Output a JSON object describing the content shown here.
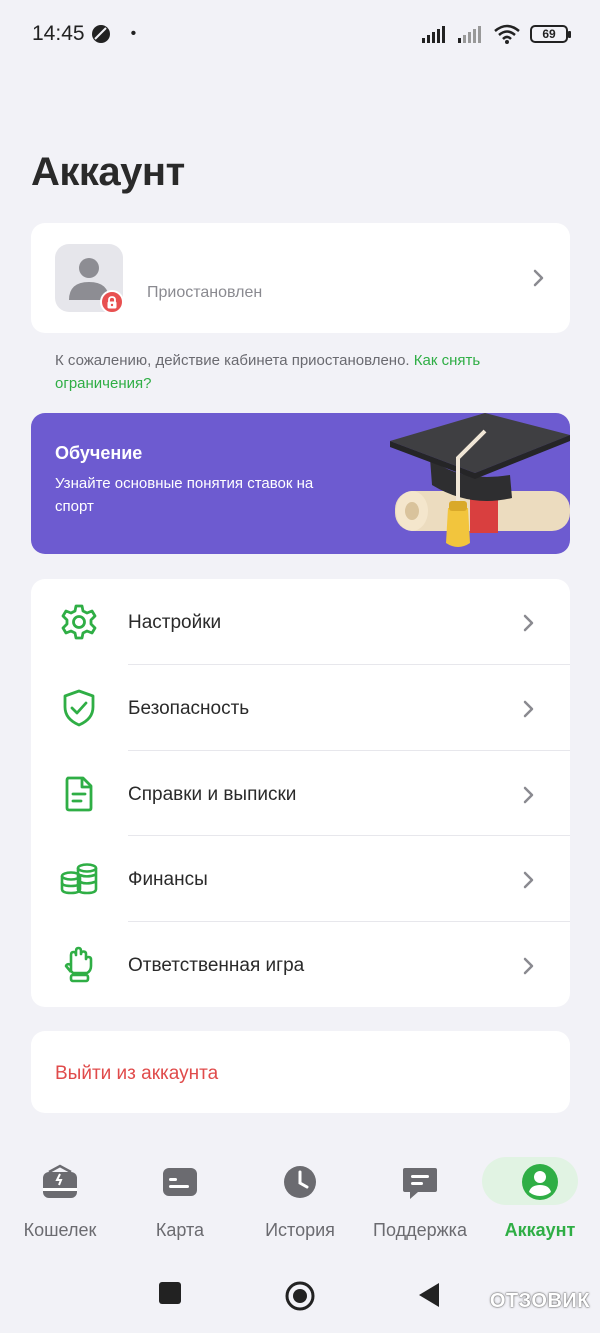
{
  "status_bar": {
    "time": "14:45",
    "battery": "69"
  },
  "page": {
    "title": "Аккаунт"
  },
  "profile": {
    "status": "Приостановлен"
  },
  "notice": {
    "text": "К сожалению, действие кабинета приостановлено.",
    "link": "Как снять ограничения?"
  },
  "promo": {
    "title": "Обучение",
    "subtitle": "Узнайте основные понятия ставок на спорт"
  },
  "menu": {
    "items": [
      {
        "label": "Настройки",
        "icon": "gear-icon"
      },
      {
        "label": "Безопасность",
        "icon": "shield-check-icon"
      },
      {
        "label": "Справки и выписки",
        "icon": "document-icon"
      },
      {
        "label": "Финансы",
        "icon": "coins-icon"
      },
      {
        "label": "Ответственная игра",
        "icon": "hand-icon"
      }
    ]
  },
  "logout": {
    "label": "Выйти из аккаунта"
  },
  "bottom_nav": {
    "items": [
      {
        "label": "Кошелек",
        "icon": "wallet-icon"
      },
      {
        "label": "Карта",
        "icon": "card-icon"
      },
      {
        "label": "История",
        "icon": "clock-icon"
      },
      {
        "label": "Поддержка",
        "icon": "chat-icon"
      },
      {
        "label": "Аккаунт",
        "icon": "account-icon",
        "active": true
      }
    ]
  },
  "watermark": "ОТЗОВИК",
  "colors": {
    "accent": "#2fae45",
    "promo": "#6d5bd0",
    "danger": "#e04b4b",
    "background": "#f2f2f7"
  }
}
